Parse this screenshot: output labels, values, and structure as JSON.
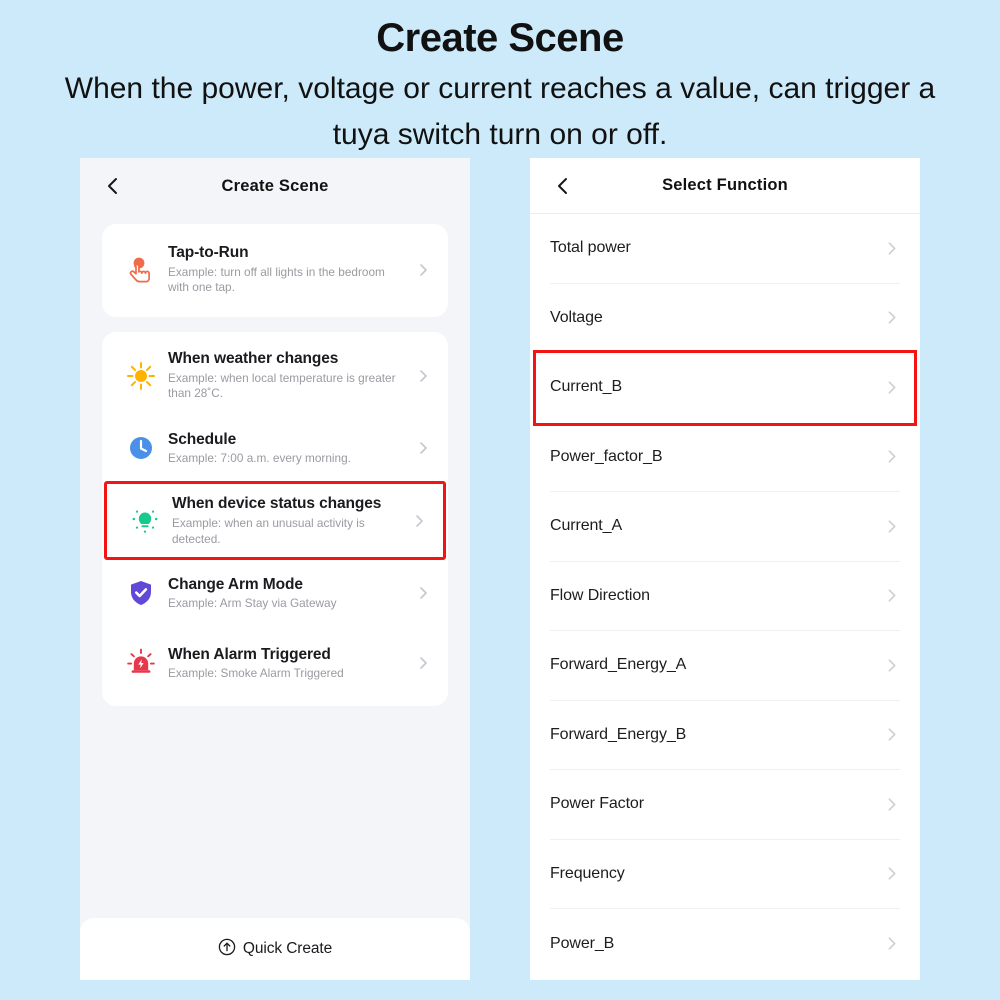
{
  "page": {
    "background_color": "#cdeafa",
    "headline": "Create Scene",
    "subline": "When the power, voltage or current reaches a value, can trigger a tuya switch turn on or off."
  },
  "highlight": {
    "color": "#f41414"
  },
  "left_panel": {
    "header": {
      "title": "Create Scene",
      "back_icon": "chevron-left-icon"
    },
    "tap_to_run_card": {
      "rows": [
        {
          "id": "tap-to-run",
          "icon": "tap-hand-icon",
          "icon_color": "#f0694a",
          "title": "Tap-to-Run",
          "description": "Example: turn off all lights in the bedroom with one tap.",
          "chevron": "chevron-right-icon"
        }
      ]
    },
    "triggers_card": {
      "rows": [
        {
          "id": "weather",
          "icon": "sun-icon",
          "icon_color": "#ffb300",
          "title": "When weather changes",
          "description": "Example: when local temperature is greater than 28˚C.",
          "chevron": "chevron-right-icon",
          "highlighted": false
        },
        {
          "id": "schedule",
          "icon": "clock-icon",
          "icon_color": "#4a90e8",
          "title": "Schedule",
          "description": "Example: 7:00 a.m. every morning.",
          "chevron": "chevron-right-icon",
          "highlighted": false
        },
        {
          "id": "device-status",
          "icon": "smart-bulb-icon",
          "icon_color": "#16c98d",
          "title": "When device status changes",
          "description": "Example: when an unusual activity is detected.",
          "chevron": "chevron-right-icon",
          "highlighted": true
        },
        {
          "id": "arm-mode",
          "icon": "shield-check-icon",
          "icon_color": "#6248d6",
          "title": "Change Arm Mode",
          "description": "Example: Arm Stay via Gateway",
          "chevron": "chevron-right-icon",
          "highlighted": false
        },
        {
          "id": "alarm-triggered",
          "icon": "alarm-siren-icon",
          "icon_color": "#e8374a",
          "title": "When Alarm Triggered",
          "description": "Example: Smoke Alarm Triggered",
          "chevron": "chevron-right-icon",
          "highlighted": false
        }
      ]
    },
    "footer": {
      "icon": "arrow-up-circle-icon",
      "label": "Quick Create"
    }
  },
  "right_panel": {
    "header": {
      "title": "Select Function",
      "back_icon": "chevron-left-icon"
    },
    "functions": [
      {
        "id": "total-power",
        "label": "Total power",
        "chevron": "chevron-right-icon",
        "highlighted": false
      },
      {
        "id": "voltage",
        "label": "Voltage",
        "chevron": "chevron-right-icon",
        "highlighted": false
      },
      {
        "id": "current-b",
        "label": "Current_B",
        "chevron": "chevron-right-icon",
        "highlighted": true
      },
      {
        "id": "power-factor-b",
        "label": "Power_factor_B",
        "chevron": "chevron-right-icon",
        "highlighted": false
      },
      {
        "id": "current-a",
        "label": "Current_A",
        "chevron": "chevron-right-icon",
        "highlighted": false
      },
      {
        "id": "flow-direction",
        "label": "Flow Direction",
        "chevron": "chevron-right-icon",
        "highlighted": false
      },
      {
        "id": "forward-energy-a",
        "label": "Forward_Energy_A",
        "chevron": "chevron-right-icon",
        "highlighted": false
      },
      {
        "id": "forward-energy-b",
        "label": "Forward_Energy_B",
        "chevron": "chevron-right-icon",
        "highlighted": false
      },
      {
        "id": "power-factor",
        "label": "Power Factor",
        "chevron": "chevron-right-icon",
        "highlighted": false
      },
      {
        "id": "frequency",
        "label": "Frequency",
        "chevron": "chevron-right-icon",
        "highlighted": false
      },
      {
        "id": "power-b",
        "label": "Power_B",
        "chevron": "chevron-right-icon",
        "highlighted": false
      }
    ]
  }
}
